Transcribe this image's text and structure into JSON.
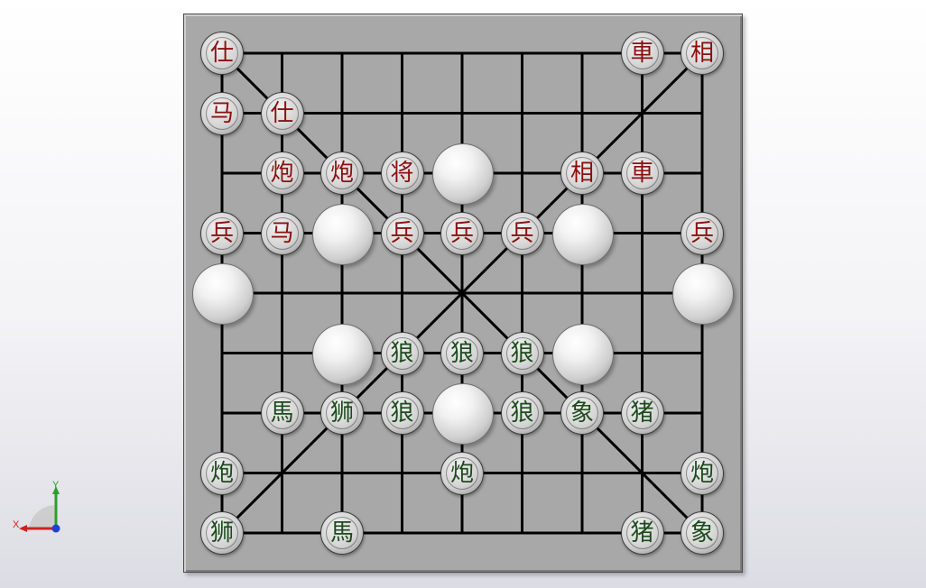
{
  "window": {
    "background": "#f3f3f6"
  },
  "board": {
    "color": "#a8a8a8",
    "line_color": "#000000"
  },
  "pieces": [
    {
      "glyph": "仕",
      "side": "red",
      "col": 0,
      "row": 0
    },
    {
      "glyph": "車",
      "side": "red",
      "col": 7,
      "row": 0
    },
    {
      "glyph": "相",
      "side": "red",
      "col": 8,
      "row": 0
    },
    {
      "glyph": "马",
      "side": "red",
      "col": 0,
      "row": 1
    },
    {
      "glyph": "仕",
      "side": "red",
      "col": 1,
      "row": 1
    },
    {
      "glyph": "炮",
      "side": "red",
      "col": 1,
      "row": 2
    },
    {
      "glyph": "炮",
      "side": "red",
      "col": 2,
      "row": 2
    },
    {
      "glyph": "将",
      "side": "red",
      "col": 3,
      "row": 2
    },
    {
      "glyph": "相",
      "side": "red",
      "col": 6,
      "row": 2
    },
    {
      "glyph": "車",
      "side": "red",
      "col": 7,
      "row": 2
    },
    {
      "glyph": "兵",
      "side": "red",
      "col": 0,
      "row": 3
    },
    {
      "glyph": "马",
      "side": "red",
      "col": 1,
      "row": 3
    },
    {
      "glyph": "兵",
      "side": "red",
      "col": 3,
      "row": 3
    },
    {
      "glyph": "兵",
      "side": "red",
      "col": 4,
      "row": 3
    },
    {
      "glyph": "兵",
      "side": "red",
      "col": 5,
      "row": 3
    },
    {
      "glyph": "兵",
      "side": "red",
      "col": 8,
      "row": 3
    },
    {
      "glyph": "狼",
      "side": "green",
      "col": 3,
      "row": 5
    },
    {
      "glyph": "狼",
      "side": "green",
      "col": 4,
      "row": 5
    },
    {
      "glyph": "狼",
      "side": "green",
      "col": 5,
      "row": 5
    },
    {
      "glyph": "馬",
      "side": "green",
      "col": 1,
      "row": 6
    },
    {
      "glyph": "狮",
      "side": "green",
      "col": 2,
      "row": 6
    },
    {
      "glyph": "狼",
      "side": "green",
      "col": 3,
      "row": 6
    },
    {
      "glyph": "狼",
      "side": "green",
      "col": 5,
      "row": 6
    },
    {
      "glyph": "象",
      "side": "green",
      "col": 6,
      "row": 6
    },
    {
      "glyph": "猪",
      "side": "green",
      "col": 7,
      "row": 6
    },
    {
      "glyph": "炮",
      "side": "green",
      "col": 0,
      "row": 7
    },
    {
      "glyph": "炮",
      "side": "green",
      "col": 4,
      "row": 7
    },
    {
      "glyph": "炮",
      "side": "green",
      "col": 8,
      "row": 7
    },
    {
      "glyph": "狮",
      "side": "green",
      "col": 0,
      "row": 8
    },
    {
      "glyph": "馬",
      "side": "green",
      "col": 2,
      "row": 8
    },
    {
      "glyph": "猪",
      "side": "green",
      "col": 7,
      "row": 8
    },
    {
      "glyph": "象",
      "side": "green",
      "col": 8,
      "row": 8
    }
  ],
  "balls": [
    {
      "col": 4,
      "row": 2
    },
    {
      "col": 2,
      "row": 3
    },
    {
      "col": 6,
      "row": 3
    },
    {
      "col": 0,
      "row": 4
    },
    {
      "col": 8,
      "row": 4
    },
    {
      "col": 2,
      "row": 5
    },
    {
      "col": 6,
      "row": 5
    },
    {
      "col": 4,
      "row": 6
    }
  ],
  "triad": {
    "y_label": "Y",
    "x_label": "X",
    "y_color": "#2aa02a",
    "x_color": "#d02020",
    "z_color": "#2040d0"
  }
}
